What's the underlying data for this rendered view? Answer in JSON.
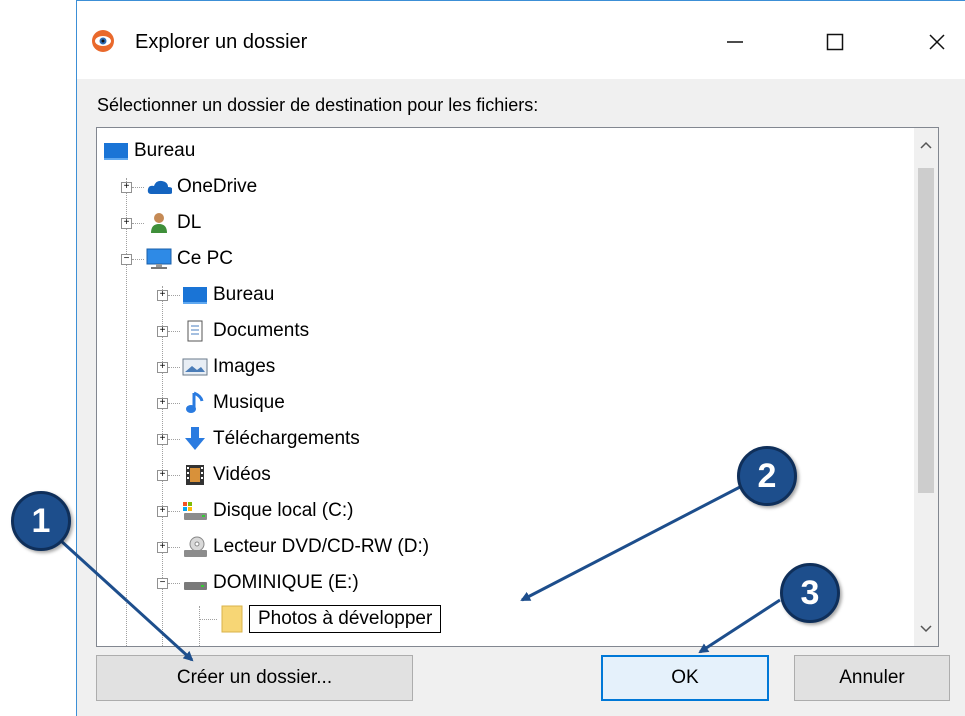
{
  "window": {
    "title": "Explorer un dossier",
    "prompt": "Sélectionner un dossier de destination pour les fichiers:"
  },
  "tree": [
    {
      "label": "Bureau",
      "icon": "desktop-icon"
    },
    {
      "label": "OneDrive",
      "icon": "cloud-icon"
    },
    {
      "label": "DL",
      "icon": "user-icon"
    },
    {
      "label": "Ce PC",
      "icon": "computer-icon"
    },
    {
      "label": "Bureau",
      "icon": "desktop-icon"
    },
    {
      "label": "Documents",
      "icon": "documents-icon"
    },
    {
      "label": "Images",
      "icon": "pictures-icon"
    },
    {
      "label": "Musique",
      "icon": "music-icon"
    },
    {
      "label": "Téléchargements",
      "icon": "download-icon"
    },
    {
      "label": "Vidéos",
      "icon": "video-icon"
    },
    {
      "label": "Disque local (C:)",
      "icon": "drive-icon"
    },
    {
      "label": "Lecteur DVD/CD-RW (D:)",
      "icon": "dvd-icon"
    },
    {
      "label": "DOMINIQUE (E:)",
      "icon": "usb-drive-icon"
    },
    {
      "label": "Photos à développer",
      "icon": "folder-icon"
    }
  ],
  "buttons": {
    "create": "Créer un dossier...",
    "ok": "OK",
    "cancel": "Annuler"
  },
  "callouts": [
    "1",
    "2",
    "3"
  ],
  "colors": {
    "accent": "#0078d7",
    "badge": "#1d4e8c"
  }
}
